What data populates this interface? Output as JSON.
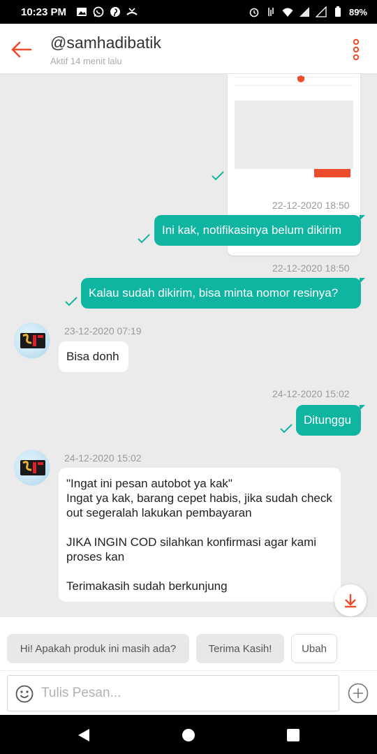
{
  "status_bar": {
    "time": "10:23 PM",
    "battery": "89%"
  },
  "header": {
    "title": "@samhadibatik",
    "subtitle": "Aktif 14 menit lalu"
  },
  "messages": {
    "ts1": "22-12-2020 18:50",
    "msg1": "Ini kak, notifikasinya belum dikirim",
    "ts2": "22-12-2020 18:50",
    "msg2": "Kalau sudah dikirim, bisa minta nomor resinya?",
    "ts3": "23-12-2020 07:19",
    "msg3": "Bisa donh",
    "ts4": "24-12-2020 15:02",
    "msg4": "Ditunggu",
    "ts5": "24-12-2020 15:02",
    "msg5": "\"Ingat ini pesan autobot ya kak\"\nIngat ya kak, barang cepet habis, jika sudah check out segeralah lakukan pembayaran\n\nJIKA INGIN COD silahkan konfirmasi agar kami proses kan\n\nTerimakasih sudah berkunjung"
  },
  "quick_replies": [
    "Hi! Apakah produk ini masih ada?",
    "Terima Kasih!",
    "Ubah"
  ],
  "input": {
    "placeholder": "Tulis Pesan..."
  },
  "colors": {
    "accent": "#ee4d2d",
    "outgoing_bubble": "#10b5a1"
  }
}
